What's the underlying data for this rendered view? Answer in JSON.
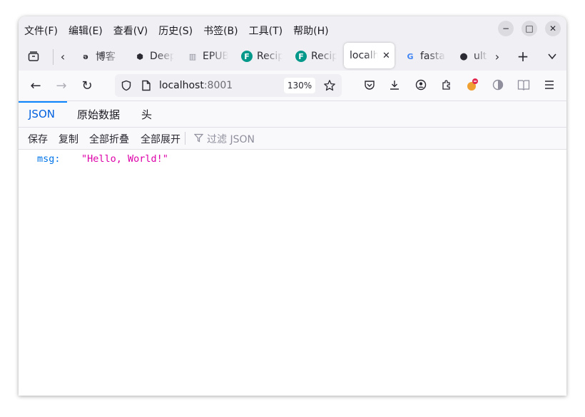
{
  "menu": [
    "文件(F)",
    "编辑(E)",
    "查看(V)",
    "历史(S)",
    "书签(B)",
    "工具(T)",
    "帮助(H)"
  ],
  "window_controls": {
    "minimize": "−",
    "maximize": "□",
    "close": "✕"
  },
  "tabs": [
    {
      "title": "博客",
      "favicon": "ə",
      "favicon_color": "#2b2a33"
    },
    {
      "title": "Deep",
      "favicon": "⬢",
      "favicon_color": "#2b2a33"
    },
    {
      "title": "EPUB",
      "favicon": "▥",
      "favicon_color": "#8f8f9d"
    },
    {
      "title": "Recip",
      "favicon": "F",
      "favicon_color": "#ffffff",
      "favicon_bg": "#05998b"
    },
    {
      "title": "Recip",
      "favicon": "F",
      "favicon_color": "#ffffff",
      "favicon_bg": "#05998b"
    },
    {
      "title": "localh",
      "active": true
    },
    {
      "title": "fasta",
      "favicon": "G",
      "favicon_color": "#4285f4"
    },
    {
      "title": "ult",
      "favicon": "●",
      "favicon_color": "#1c1b22"
    }
  ],
  "tabstrip": {
    "new_tab": "+",
    "list_all": "⌄",
    "scroll_left": "‹",
    "scroll_right": "›",
    "tab_close": "✕"
  },
  "nav": {
    "back": "←",
    "forward": "→",
    "reload": "↻",
    "url_host": "localhost",
    "url_port": ":8001",
    "zoom": "130%"
  },
  "viewer": {
    "tabs": [
      "JSON",
      "原始数据",
      "头"
    ],
    "toolbar": {
      "save": "保存",
      "copy": "复制",
      "collapse_all": "全部折叠",
      "expand_all": "全部展开",
      "filter_placeholder": "过滤 JSON"
    },
    "rows": [
      {
        "key": "msg:",
        "value": "\"Hello, World!\""
      }
    ]
  },
  "colors": {
    "accent": "#0a84ff",
    "json_key": "#0074e8",
    "json_string": "#dd00a9"
  }
}
